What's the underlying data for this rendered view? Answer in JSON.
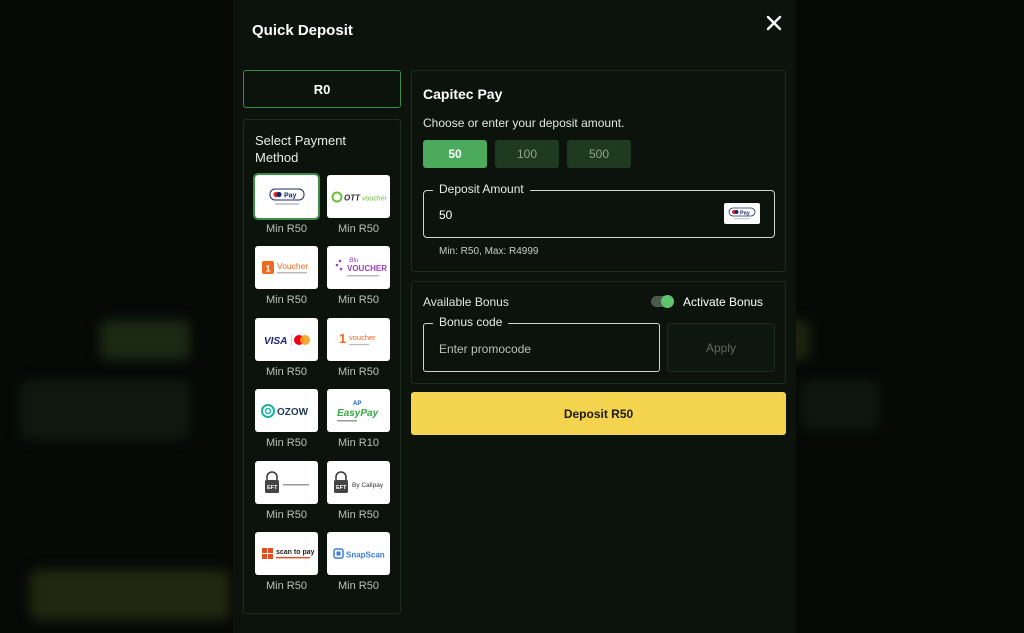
{
  "modal": {
    "title": "Quick Deposit",
    "balance": "R0"
  },
  "methods": {
    "title": "Select Payment Method",
    "items": [
      {
        "name": "Capitec Pay",
        "min": "Min R50",
        "logo": "Pay",
        "selected": true
      },
      {
        "name": "OTT Voucher",
        "min": "Min R50",
        "logo": "OTT voucher"
      },
      {
        "name": "1Voucher",
        "min": "Min R50",
        "logo": "Voucher"
      },
      {
        "name": "Blu Voucher",
        "min": "Min R50",
        "logo": "VOUCHER"
      },
      {
        "name": "Visa Mastercard",
        "min": "Min R50",
        "logo": "VISA"
      },
      {
        "name": "1Voucher Callpay",
        "min": "Min R50",
        "logo": "voucher"
      },
      {
        "name": "Ozow",
        "min": "Min R50",
        "logo": "OZOW"
      },
      {
        "name": "EasyPay",
        "min": "Min R10",
        "logo": "EasyPay"
      },
      {
        "name": "EFT",
        "min": "Min R50",
        "logo": "EFT"
      },
      {
        "name": "EFT Callpay",
        "min": "Min R50",
        "logo": "By Callpay"
      },
      {
        "name": "Scan to Pay",
        "min": "Min R50",
        "logo": "scan to pay"
      },
      {
        "name": "SnapScan",
        "min": "Min R50",
        "logo": "SnapScan"
      }
    ]
  },
  "deposit": {
    "method_title": "Capitec Pay",
    "instruction": "Choose or enter your deposit amount.",
    "amounts": [
      "50",
      "100",
      "500"
    ],
    "amount_label": "Deposit Amount",
    "amount_value": "50",
    "amount_logo": "Pay",
    "limits": "Min: R50, Max: R4999"
  },
  "bonus": {
    "available_label": "Available Bonus",
    "activate_label": "Activate Bonus",
    "activate_on": true,
    "code_label": "Bonus code",
    "code_placeholder": "Enter promocode",
    "apply_label": "Apply"
  },
  "submit": {
    "label": "Deposit R50"
  },
  "colors": {
    "accent": "#4caa5c",
    "cta": "#f4d34f",
    "panel_bg": "#0b130c"
  }
}
